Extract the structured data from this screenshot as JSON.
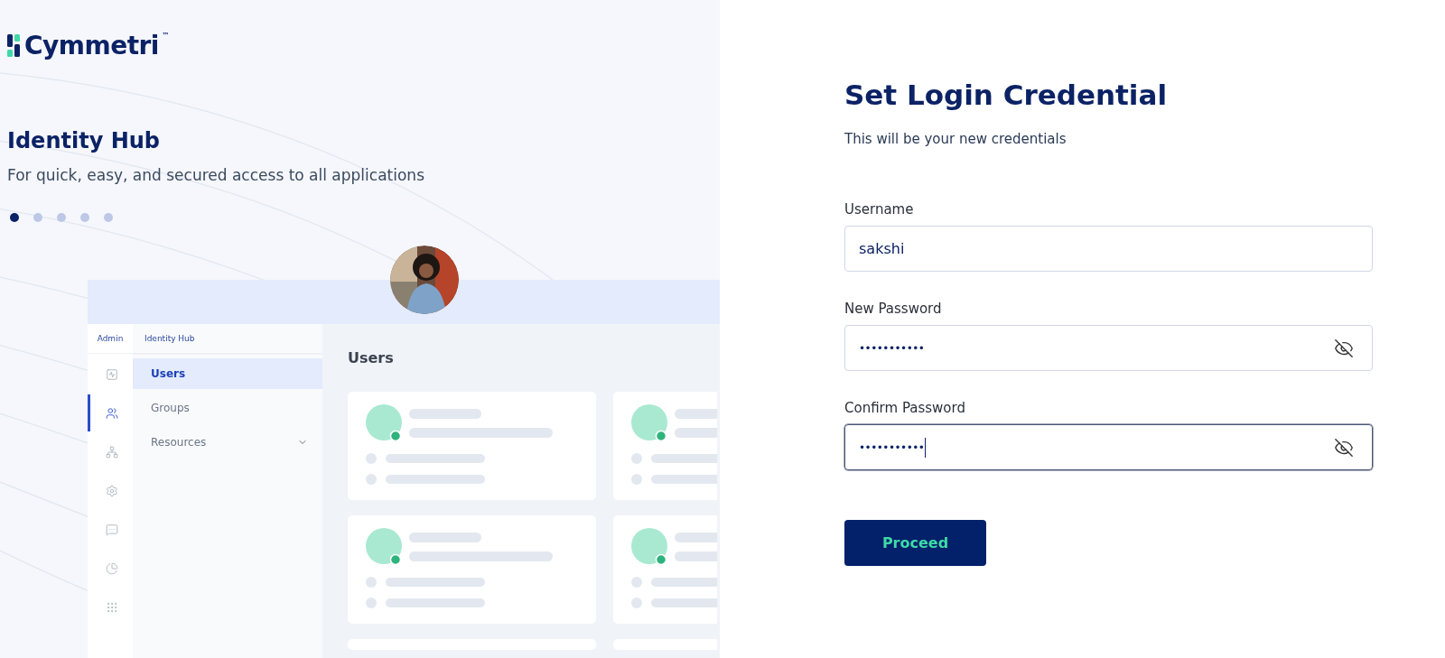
{
  "brand": {
    "name": "Cymmetri",
    "trademark": "™"
  },
  "hero": {
    "title": "Identity Hub",
    "subtitle": "For quick, easy, and secured access to all applications",
    "slides": [
      {
        "selected": true
      },
      {
        "selected": false
      },
      {
        "selected": false
      },
      {
        "selected": false
      },
      {
        "selected": false
      }
    ]
  },
  "preview": {
    "rail_label": "Admin",
    "rail_icons": [
      {
        "kind": "chart",
        "selected": false
      },
      {
        "kind": "users",
        "selected": true
      },
      {
        "kind": "tree",
        "selected": false
      },
      {
        "kind": "settings",
        "selected": false
      },
      {
        "kind": "chat",
        "selected": false
      },
      {
        "kind": "pie",
        "selected": false
      },
      {
        "kind": "apps",
        "selected": false
      }
    ],
    "nav_title": "Identity Hub",
    "nav_items": [
      {
        "label": "Users",
        "selected": true,
        "expandable": false
      },
      {
        "label": "Groups",
        "selected": false,
        "expandable": false
      },
      {
        "label": "Resources",
        "selected": false,
        "expandable": true
      }
    ],
    "page_title": "Users"
  },
  "form": {
    "title": "Set Login Credential",
    "subtitle": "This will be your new credentials",
    "fields": [
      {
        "label": "Username",
        "value": "sakshi",
        "kind": "text",
        "focused": false
      },
      {
        "label": "New Password",
        "value": "•••••••••••",
        "kind": "password",
        "focused": false
      },
      {
        "label": "Confirm Password",
        "value": "•••••••••••",
        "kind": "password",
        "focused": true
      }
    ],
    "button": "Proceed"
  }
}
